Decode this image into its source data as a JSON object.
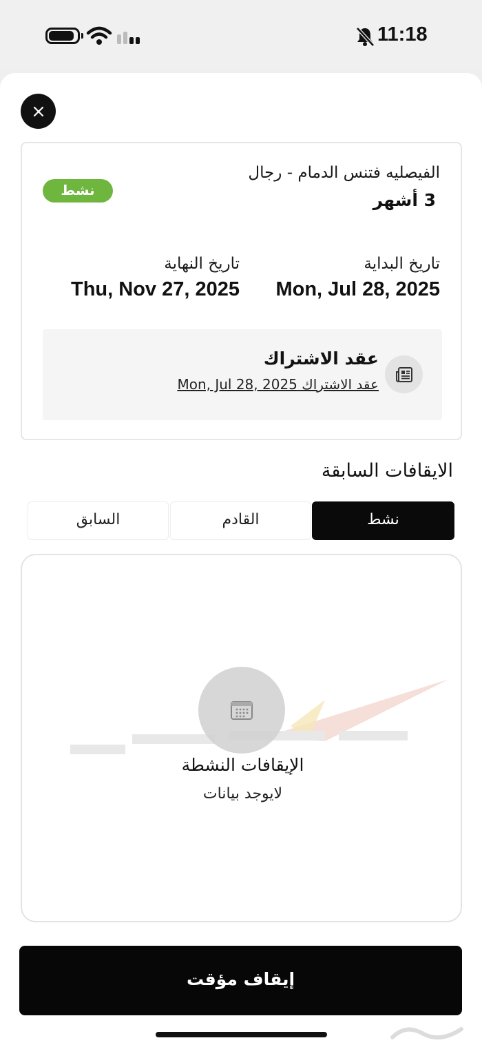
{
  "status_bar": {
    "time": "11:18",
    "icons": [
      "battery-icon",
      "wifi-icon",
      "cellular-signal-icon",
      "bell-slash-icon"
    ]
  },
  "header": {
    "close_icon": "close-icon"
  },
  "membership": {
    "status_badge": "نشط",
    "club_name": "الفيصليه فتنس الدمام - رجال",
    "duration": "3 أشهر",
    "start_label": "تاريخ البداية",
    "start_date": "Mon, Jul 28, 2025",
    "end_label": "تاريخ النهاية",
    "end_date": "Thu, Nov 27, 2025",
    "badge_color": "#6fb63f"
  },
  "contract": {
    "title": "عقد الاشتراك",
    "link_text": "عقد الاشتراك Mon, Jul 28, 2025",
    "icon": "newspaper-icon"
  },
  "freezes": {
    "section_title": "الايقافات السابقة",
    "tabs": [
      {
        "label": "نشط",
        "active": true
      },
      {
        "label": "القادم",
        "active": false
      },
      {
        "label": "السابق",
        "active": false
      }
    ],
    "empty_icon": "calendar-icon",
    "empty_title": "الإيقافات النشطة",
    "empty_subtitle": "لايوجد بيانات"
  },
  "actions": {
    "pause_label": "إيقاف مؤقت"
  },
  "colors": {
    "primary": "#0a0a0a",
    "accent_green": "#6fb63f",
    "background": "#ffffff"
  }
}
